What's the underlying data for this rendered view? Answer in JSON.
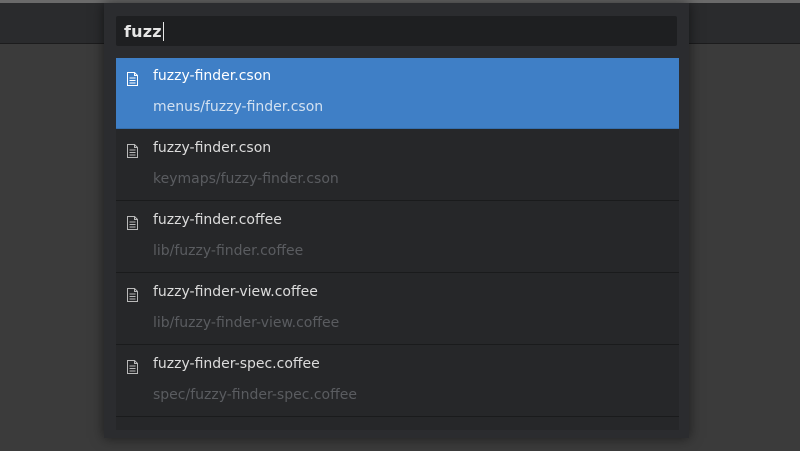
{
  "search": {
    "value": "fuzz"
  },
  "results": [
    {
      "title": "fuzzy-finder.cson",
      "path": "menus/fuzzy-finder.cson",
      "icon": "file-text-icon",
      "selected": true
    },
    {
      "title": "fuzzy-finder.cson",
      "path": "keymaps/fuzzy-finder.cson",
      "icon": "file-text-icon",
      "selected": false
    },
    {
      "title": "fuzzy-finder.coffee",
      "path": "lib/fuzzy-finder.coffee",
      "icon": "file-text-icon",
      "selected": false
    },
    {
      "title": "fuzzy-finder-view.coffee",
      "path": "lib/fuzzy-finder-view.coffee",
      "icon": "file-text-icon",
      "selected": false
    },
    {
      "title": "fuzzy-finder-spec.coffee",
      "path": "spec/fuzzy-finder-spec.coffee",
      "icon": "file-text-icon",
      "selected": false
    }
  ],
  "colors": {
    "selection": "#3f7fc6",
    "panel_background": "#2b2c2f",
    "editor_background": "#3b3b3b"
  }
}
